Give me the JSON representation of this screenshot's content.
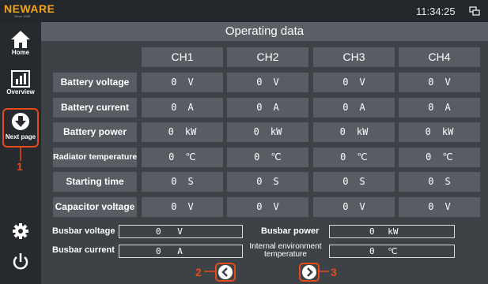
{
  "topbar": {
    "logo": "NEWARE",
    "logo_sub": "Since 1998",
    "clock": "11:34:25",
    "status_icon": "network-icon"
  },
  "sidebar": {
    "home_label": "Home",
    "overview_label": "Overview",
    "next_page_label": "Next page"
  },
  "annotations": {
    "callout_1": "1",
    "callout_2": "2",
    "callout_3": "3",
    "highlight_color": "#e64a19"
  },
  "main": {
    "title": "Operating data",
    "channels": [
      "CH1",
      "CH2",
      "CH3",
      "CH4"
    ],
    "rows": [
      {
        "label": "Battery voltage",
        "values": [
          {
            "v": "0",
            "u": "V"
          },
          {
            "v": "0",
            "u": "V"
          },
          {
            "v": "0",
            "u": "V"
          },
          {
            "v": "0",
            "u": "V"
          }
        ]
      },
      {
        "label": "Battery current",
        "values": [
          {
            "v": "0",
            "u": "A"
          },
          {
            "v": "0",
            "u": "A"
          },
          {
            "v": "0",
            "u": "A"
          },
          {
            "v": "0",
            "u": "A"
          }
        ]
      },
      {
        "label": "Battery power",
        "values": [
          {
            "v": "0",
            "u": "kW"
          },
          {
            "v": "0",
            "u": "kW"
          },
          {
            "v": "0",
            "u": "kW"
          },
          {
            "v": "0",
            "u": "kW"
          }
        ]
      },
      {
        "label": "Radiator temperature",
        "values": [
          {
            "v": "0",
            "u": "℃"
          },
          {
            "v": "0",
            "u": "℃"
          },
          {
            "v": "0",
            "u": "℃"
          },
          {
            "v": "0",
            "u": "℃"
          }
        ]
      },
      {
        "label": "Starting time",
        "values": [
          {
            "v": "0",
            "u": "S"
          },
          {
            "v": "0",
            "u": "S"
          },
          {
            "v": "0",
            "u": "S"
          },
          {
            "v": "0",
            "u": "S"
          }
        ]
      },
      {
        "label": "Capacitor voltage",
        "values": [
          {
            "v": "0",
            "u": "V"
          },
          {
            "v": "0",
            "u": "V"
          },
          {
            "v": "0",
            "u": "V"
          },
          {
            "v": "0",
            "u": "V"
          }
        ]
      }
    ]
  },
  "bus": {
    "voltage_label": "Busbar voltage",
    "voltage_value": "0",
    "voltage_unit": "V",
    "current_label": "Busbar current",
    "current_value": "0",
    "current_unit": "A",
    "power_label": "Busbar power",
    "power_value": "0",
    "power_unit": "kW",
    "env_temp_label_line1": "Internal environment",
    "env_temp_label_line2": "temperature",
    "env_temp_value": "0",
    "env_temp_unit": "℃"
  },
  "pager": {
    "prev_icon": "chevron-left-icon",
    "next_icon": "chevron-right-icon"
  }
}
